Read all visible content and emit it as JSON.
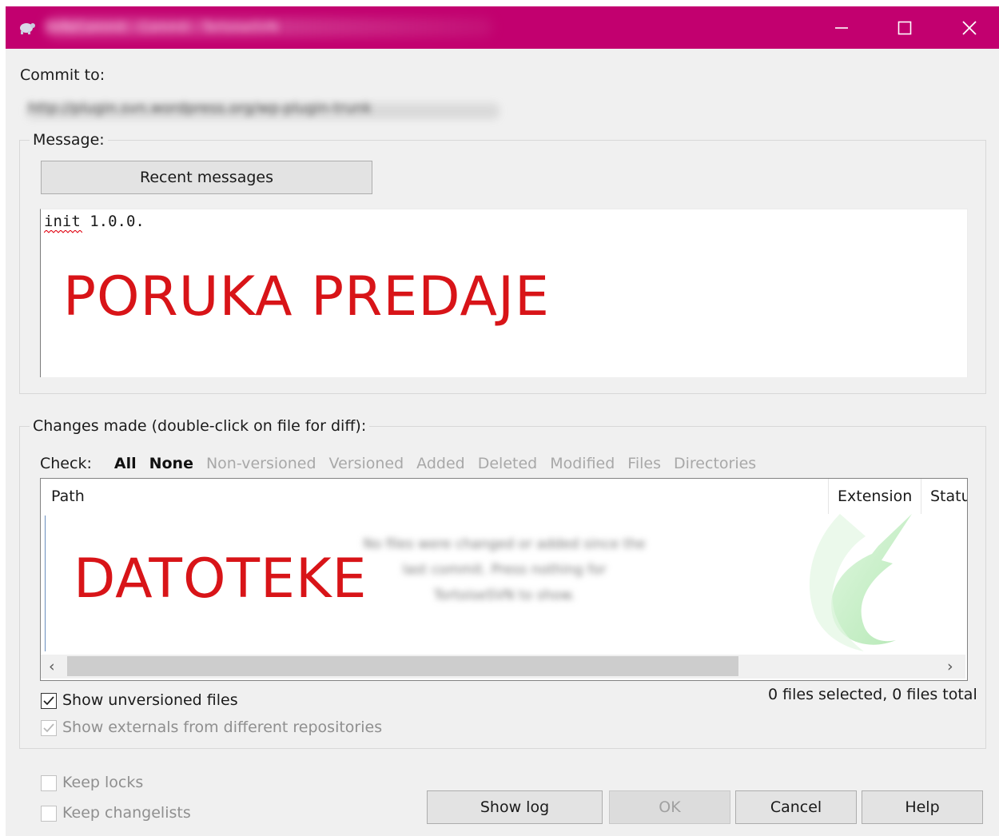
{
  "window": {
    "title": "SVN/Commit - Commit - TortoiseSVN",
    "accent_color": "#c2006f",
    "controls": {
      "minimize": "minimize-icon",
      "maximize": "maximize-icon",
      "close": "close-icon"
    }
  },
  "commit_to": {
    "label": "Commit to:",
    "url": "http://plugin.svn.wordpress.org/wp-plugin-trunk"
  },
  "message": {
    "group_label": "Message:",
    "recent_button": "Recent messages",
    "text": "init 1.0.0.",
    "annotation": "PORUKA PREDAJE",
    "annotation_color": "#d81418"
  },
  "changes": {
    "group_label": "Changes made (double-click on file for diff):",
    "check_label": "Check:",
    "filters": [
      {
        "label": "All",
        "enabled": true
      },
      {
        "label": "None",
        "enabled": true
      },
      {
        "label": "Non-versioned",
        "enabled": false
      },
      {
        "label": "Versioned",
        "enabled": false
      },
      {
        "label": "Added",
        "enabled": false
      },
      {
        "label": "Deleted",
        "enabled": false
      },
      {
        "label": "Modified",
        "enabled": false
      },
      {
        "label": "Files",
        "enabled": false
      },
      {
        "label": "Directories",
        "enabled": false
      }
    ],
    "columns": [
      "Path",
      "Extension",
      "Statu"
    ],
    "empty_message": "No files were changed or added since the last commit. Press nothing for TortoiseSVN to show.",
    "annotation": "DATOTEKE",
    "status_summary": "0 files selected, 0 files total",
    "show_unversioned": {
      "label": "Show unversioned files",
      "checked": true
    },
    "show_externals": {
      "label": "Show externals from different repositories",
      "checked": true,
      "enabled": false
    }
  },
  "options": {
    "keep_locks": {
      "label": "Keep locks",
      "checked": false
    },
    "keep_changelists": {
      "label": "Keep changelists",
      "checked": false
    }
  },
  "buttons": {
    "show_log": "Show log",
    "ok": "OK",
    "cancel": "Cancel",
    "help": "Help"
  }
}
